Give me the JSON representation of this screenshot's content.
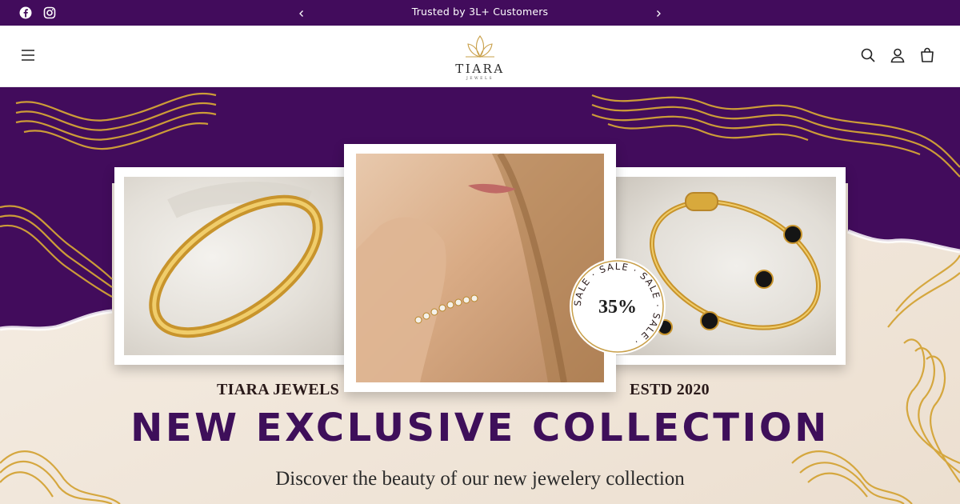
{
  "announcement": {
    "text": "Trusted by 3L+ Customers",
    "social_icons": [
      "facebook-icon",
      "instagram-icon"
    ],
    "prev_icon": "chevron-left-icon",
    "next_icon": "chevron-right-icon",
    "background": "#420c5c"
  },
  "header": {
    "menu_icon": "hamburger-menu-icon",
    "logo": {
      "name": "TIARA",
      "tagline": "JEWELS"
    },
    "icons": [
      "search-icon",
      "account-icon",
      "cart-icon"
    ]
  },
  "hero": {
    "left_label": "TIARA JEWELS",
    "right_label": "ESTD 2020",
    "title": "NEW EXCLUSIVE COLLECTION",
    "subtitle": "Discover the beauty of our new jewelery collection",
    "badge": {
      "value": "35%",
      "ring_text": "SALE · SALE · SALE · SALE ·"
    },
    "colors": {
      "purple": "#420c5c",
      "gold": "#d4a437",
      "cream": "#f2e9df"
    }
  }
}
